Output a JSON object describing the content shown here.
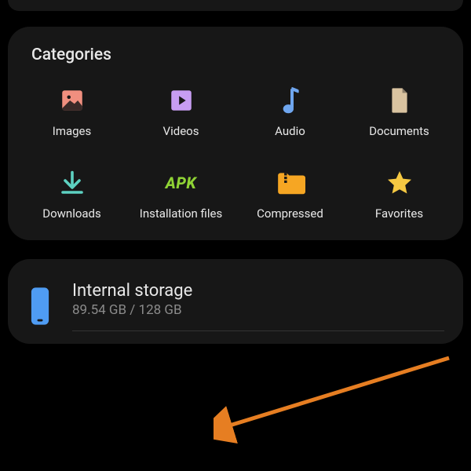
{
  "categories": {
    "title": "Categories",
    "items": [
      {
        "name": "images-icon",
        "label": "Images"
      },
      {
        "name": "videos-icon",
        "label": "Videos"
      },
      {
        "name": "audio-icon",
        "label": "Audio"
      },
      {
        "name": "documents-icon",
        "label": "Documents"
      },
      {
        "name": "downloads-icon",
        "label": "Downloads"
      },
      {
        "name": "apk-icon",
        "label": "Installation files"
      },
      {
        "name": "compressed-icon",
        "label": "Compressed"
      },
      {
        "name": "favorites-icon",
        "label": "Favorites"
      }
    ]
  },
  "storage": {
    "title": "Internal storage",
    "used_free": "89.54 GB / 128 GB"
  },
  "colors": {
    "images": "#f08f7f",
    "videos": "#c79df2",
    "audio": "#6fa6ef",
    "documents": "#d9c3a0",
    "downloads": "#5dd1c1",
    "apk": "#8fd235",
    "compressed": "#f6a623",
    "favorites": "#f5c842",
    "device": "#4f9cf3",
    "arrow": "#e67e22"
  }
}
